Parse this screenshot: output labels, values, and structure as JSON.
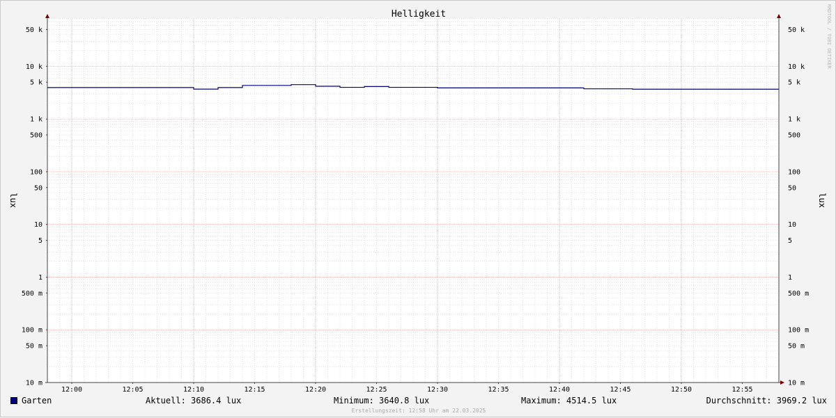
{
  "chart_data": {
    "type": "line",
    "title": "Helligkeit",
    "ylabel": "lux",
    "ylabel_right": "lux",
    "watermark": "RRDTOOL / TOBI OETIKER",
    "y_scale": "log",
    "ylim": [
      0.01,
      80000
    ],
    "y_ticks": [
      {
        "value": 50000,
        "label": "50 k"
      },
      {
        "value": 10000,
        "label": "10 k"
      },
      {
        "value": 5000,
        "label": "5 k"
      },
      {
        "value": 1000,
        "label": "1 k"
      },
      {
        "value": 500,
        "label": "500"
      },
      {
        "value": 100,
        "label": "100"
      },
      {
        "value": 50,
        "label": "50"
      },
      {
        "value": 10,
        "label": "10"
      },
      {
        "value": 5,
        "label": "5"
      },
      {
        "value": 1,
        "label": "1"
      },
      {
        "value": 0.5,
        "label": "500 m"
      },
      {
        "value": 0.1,
        "label": "100 m"
      },
      {
        "value": 0.05,
        "label": "50 m"
      },
      {
        "value": 0.01,
        "label": "10 m"
      }
    ],
    "xlim": [
      "11:58",
      "12:58"
    ],
    "x_ticks": [
      "12:00",
      "12:05",
      "12:10",
      "12:15",
      "12:20",
      "12:25",
      "12:30",
      "12:35",
      "12:40",
      "12:45",
      "12:50",
      "12:55"
    ],
    "grid": true,
    "legend_position": "bottom",
    "series": [
      {
        "name": "Garten",
        "color": "#000080",
        "x": [
          "11:58",
          "12:10",
          "12:12",
          "12:14",
          "12:18",
          "12:20",
          "12:22",
          "12:24",
          "12:26",
          "12:30",
          "12:42",
          "12:46",
          "12:58"
        ],
        "values": [
          3960,
          3700,
          3960,
          4350,
          4500,
          4200,
          4000,
          4150,
          4000,
          3900,
          3750,
          3690,
          3690
        ]
      }
    ]
  },
  "legend": {
    "series_name": "Garten",
    "swatch_color": "#000080",
    "current": "Aktuell: 3686.4 lux",
    "minimum": "Minimum: 3640.8 lux",
    "maximum": "Maximum: 4514.5 lux",
    "average": "Durchschnitt: 3969.2 lux"
  },
  "footer": {
    "timestamp": "Erstellungszeit: 12:58 Uhr am 22.03.2025"
  },
  "colors": {
    "background": "#f3f3f3",
    "plot_background": "#ffffff",
    "minor_grid": "#cfcfcf",
    "major_grid": "#e8a0a0",
    "axis": "#800000"
  }
}
